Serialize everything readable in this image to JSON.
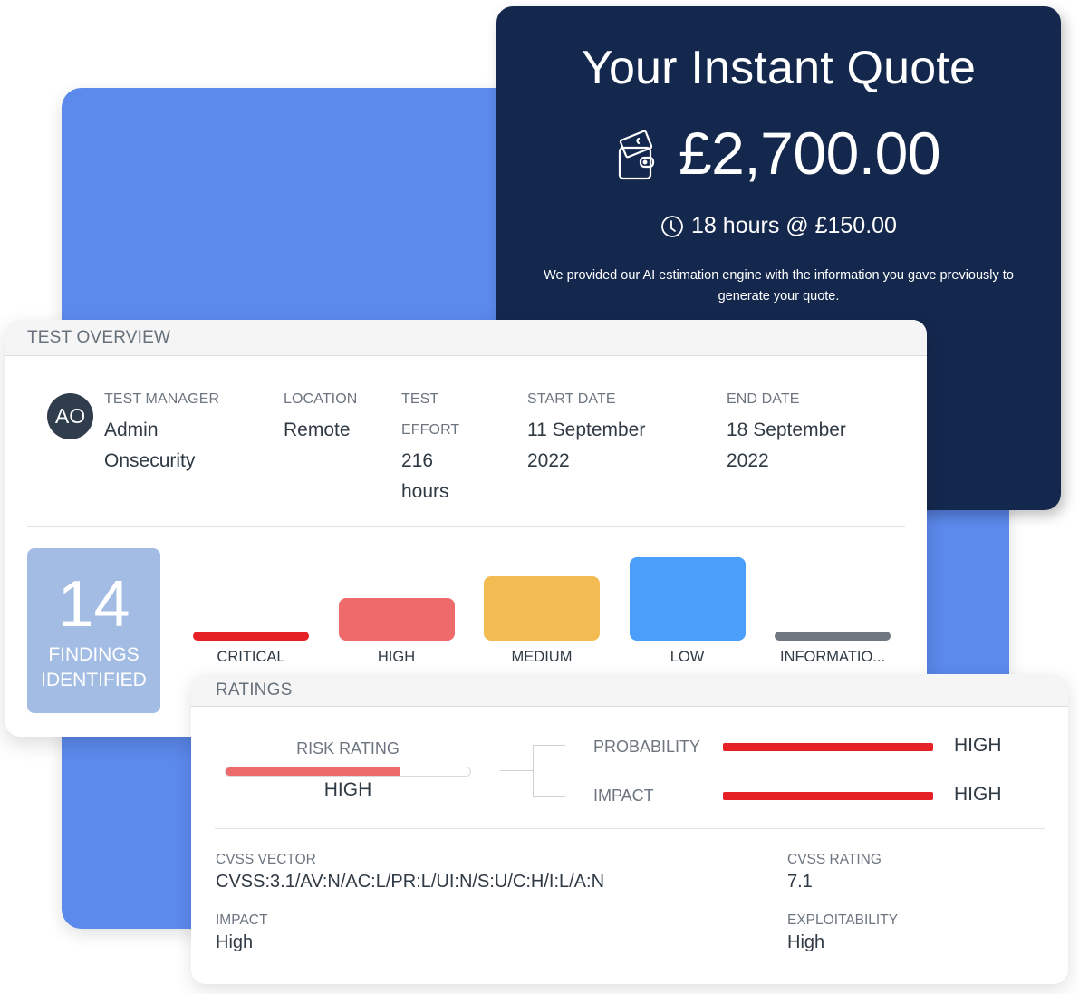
{
  "quote": {
    "title": "Your Instant Quote",
    "price": "£2,700.00",
    "hours_text": "18 hours @ £150.00",
    "description": "We provided our AI estimation engine with the information you gave previously to generate your quote.",
    "icons": {
      "price": "wallet-icon",
      "hours": "clock-icon"
    }
  },
  "overview": {
    "header": "TEST OVERVIEW",
    "avatar_initials": "AO",
    "fields": {
      "test_manager": {
        "label": "TEST MANAGER",
        "value_line1": "Admin",
        "value_line2": "Onsecurity"
      },
      "location": {
        "label": "LOCATION",
        "value": "Remote"
      },
      "test_effort": {
        "label_line1": "TEST",
        "label_line2": "EFFORT",
        "value_line1": "216",
        "value_line2": "hours"
      },
      "start_date": {
        "label": "START DATE",
        "value_line1": "11 September",
        "value_line2": "2022"
      },
      "end_date": {
        "label": "END DATE",
        "value_line1": "18 September",
        "value_line2": "2022"
      }
    },
    "findings": {
      "count": "14",
      "label_line1": "FINDINGS",
      "label_line2": "IDENTIFIED"
    },
    "severity": [
      {
        "label": "CRITICAL",
        "relative_level": 0.0,
        "color": "#e52125"
      },
      {
        "label": "HIGH",
        "relative_level": 0.45,
        "color": "#ef6b6b"
      },
      {
        "label": "MEDIUM",
        "relative_level": 0.75,
        "color": "#f2bc52"
      },
      {
        "label": "LOW",
        "relative_level": 1.0,
        "color": "#4a9ffb"
      },
      {
        "label": "INFORMATIO...",
        "relative_level": 0.0,
        "color": "#6e7780"
      }
    ]
  },
  "ratings": {
    "header": "RATINGS",
    "risk_rating": {
      "label": "RISK RATING",
      "value": "HIGH",
      "progress_percent": 71,
      "color": "#ee6b6b"
    },
    "probability": {
      "label": "PROBABILITY",
      "value": "HIGH",
      "color": "#e52125"
    },
    "impact": {
      "label": "IMPACT",
      "value": "HIGH",
      "color": "#e52125"
    },
    "cvss_vector": {
      "label": "CVSS VECTOR",
      "value": "CVSS:3.1/AV:N/AC:L/PR:L/UI:N/S:U/C:H/I:L/A:N"
    },
    "cvss_rating": {
      "label": "CVSS RATING",
      "value": "7.1"
    },
    "impact_detail": {
      "label": "IMPACT",
      "value": "High"
    },
    "exploitability": {
      "label": "EXPLOITABILITY",
      "value": "High"
    }
  },
  "colors": {
    "background_panel": "#5b89ec",
    "quote_card": "#14274d",
    "findings_box": "#a3bce3",
    "avatar": "#2f3d4c"
  }
}
